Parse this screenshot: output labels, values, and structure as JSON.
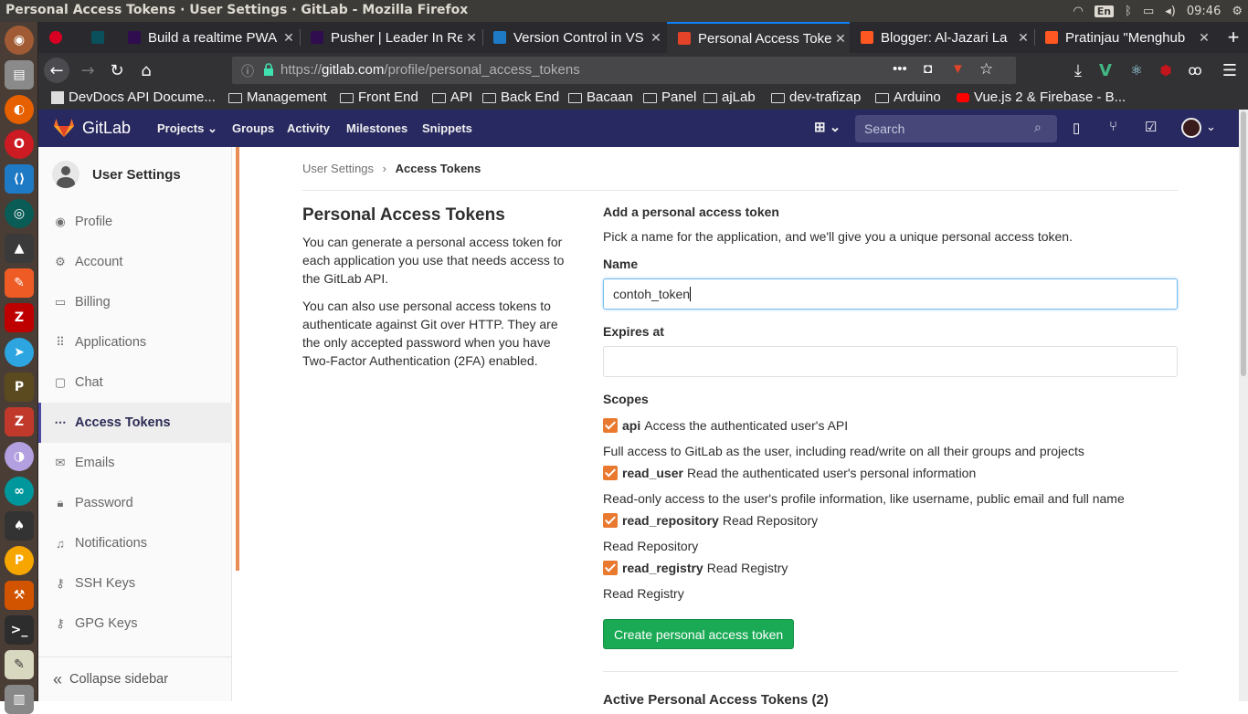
{
  "window": {
    "title": "Personal Access Tokens · User Settings · GitLab - Mozilla Firefox"
  },
  "system_tray": {
    "lang": "En",
    "clock": "09:46"
  },
  "tabs": [
    {
      "label": "Build a realtime PWA"
    },
    {
      "label": "Pusher | Leader In Re"
    },
    {
      "label": "Version Control in VS"
    },
    {
      "label": "Personal Access Toke"
    },
    {
      "label": "Blogger: Al-Jazari La"
    },
    {
      "label": "Pratinjau \"Menghub"
    }
  ],
  "address": {
    "prefix": "https://",
    "domain": "gitlab.com",
    "path": "/profile/personal_access_tokens"
  },
  "bookmarks": [
    {
      "label": "DevDocs API Docume..."
    },
    {
      "label": "Management"
    },
    {
      "label": "Front End"
    },
    {
      "label": "API"
    },
    {
      "label": "Back End"
    },
    {
      "label": "Bacaan"
    },
    {
      "label": "Panel"
    },
    {
      "label": "ajLab"
    },
    {
      "label": "dev-trafizap"
    },
    {
      "label": "Arduino"
    },
    {
      "label": "Vue.js 2 & Firebase - B..."
    }
  ],
  "gitlab": {
    "brand": "GitLab",
    "nav": {
      "projects": "Projects",
      "groups": "Groups",
      "activity": "Activity",
      "milestones": "Milestones",
      "snippets": "Snippets"
    },
    "search_placeholder": "Search"
  },
  "sidebar": {
    "title": "User Settings",
    "items": [
      {
        "label": "Profile",
        "icon": "profile-icon"
      },
      {
        "label": "Account",
        "icon": "account-icon"
      },
      {
        "label": "Billing",
        "icon": "billing-icon"
      },
      {
        "label": "Applications",
        "icon": "applications-icon"
      },
      {
        "label": "Chat",
        "icon": "chat-icon"
      },
      {
        "label": "Access Tokens",
        "icon": "access-tokens-icon"
      },
      {
        "label": "Emails",
        "icon": "email-icon"
      },
      {
        "label": "Password",
        "icon": "lock-icon"
      },
      {
        "label": "Notifications",
        "icon": "bell-icon"
      },
      {
        "label": "SSH Keys",
        "icon": "key-icon"
      },
      {
        "label": "GPG Keys",
        "icon": "key-icon"
      }
    ],
    "collapse": "Collapse sidebar",
    "accent": "#4b4ba3"
  },
  "breadcrumb": {
    "parent": "User Settings",
    "sep": "›",
    "current": "Access Tokens"
  },
  "left": {
    "heading": "Personal Access Tokens",
    "p1": "You can generate a personal access token for each application you use that needs access to the GitLab API.",
    "p2": "You can also use personal access tokens to authenticate against Git over HTTP. They are the only accepted password when you have Two-Factor Authentication (2FA) enabled."
  },
  "form": {
    "heading": "Add a personal access token",
    "intro": "Pick a name for the application, and we'll give you a unique personal access token.",
    "name_label": "Name",
    "name_value": "contoh_token",
    "expires_label": "Expires at",
    "expires_value": "",
    "scopes_label": "Scopes",
    "scopes": [
      {
        "name": "api",
        "desc": "Access the authenticated user's API",
        "detail": "Full access to GitLab as the user, including read/write on all their groups and projects"
      },
      {
        "name": "read_user",
        "desc": "Read the authenticated user's personal information",
        "detail": "Read-only access to the user's profile information, like username, public email and full name"
      },
      {
        "name": "read_repository",
        "desc": "Read Repository",
        "detail": "Read Repository"
      },
      {
        "name": "read_registry",
        "desc": "Read Registry",
        "detail": "Read Registry"
      }
    ],
    "submit": "Create personal access token",
    "active_heading": "Active Personal Access Tokens (2)",
    "submit_color": "#1aaa55",
    "checkbox_color": "#e9792f"
  }
}
